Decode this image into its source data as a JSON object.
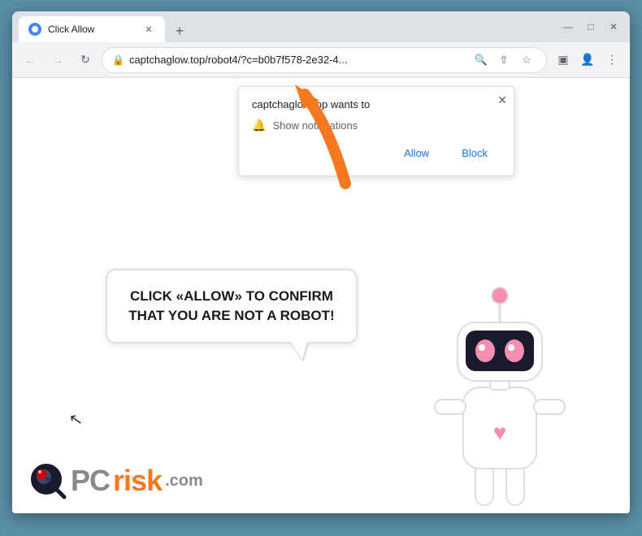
{
  "browser": {
    "tab": {
      "title": "Click Allow",
      "favicon": "globe"
    },
    "window_controls": {
      "minimize": "—",
      "maximize": "□",
      "close": "✕"
    },
    "address_bar": {
      "url": "captchaglow.top/robot4/?c=b0b7f578-2e32-4...",
      "lock_icon": "🔒"
    }
  },
  "notification_popup": {
    "site": "captchaglow.top wants to",
    "notification_label": "Show notifications",
    "allow_button": "Allow",
    "block_button": "Block"
  },
  "speech_bubble": {
    "text": "CLICK «ALLOW» TO CONFIRM THAT YOU ARE NOT A ROBOT!"
  },
  "logo": {
    "pc": "PC",
    "risk": "risk",
    "com": ".com"
  },
  "colors": {
    "orange_arrow": "#f47920",
    "bubble_border": "#e0e0e0",
    "browser_bg": "#dee1e6",
    "page_bg": "#ffffff",
    "accent": "#1a73e8"
  }
}
